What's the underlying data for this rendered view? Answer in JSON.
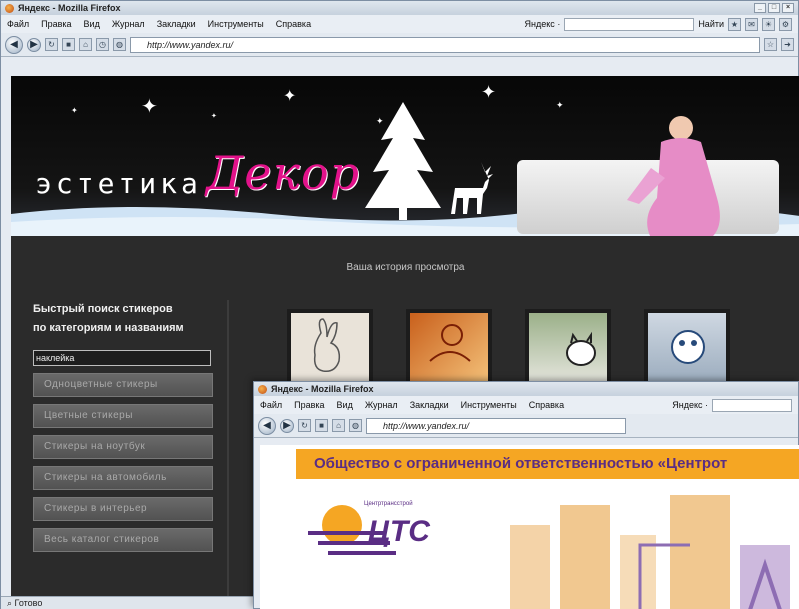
{
  "window": {
    "title": "Яндекс - Mozilla Firefox",
    "controls": [
      "_",
      "□",
      "×"
    ]
  },
  "menu": [
    "Файл",
    "Правка",
    "Вид",
    "Журнал",
    "Закладки",
    "Инструменты",
    "Справка"
  ],
  "toolbar": {
    "yandex_label": "Яндекс ·",
    "find_label": "Найти",
    "url": "http://www.yandex.ru/"
  },
  "site": {
    "brand_left": "эстетика",
    "brand_right": "Декор",
    "history_link": "Ваша история просмотра",
    "sidebar_heading_1": "Быстрый поиск стикеров",
    "sidebar_heading_2": "по категориям и названиям",
    "search_value": "наклейка",
    "categories": [
      "Одноцветные стикеры",
      "Цветные стикеры",
      "Стикеры на ноутбук",
      "Стикеры на автомобиль",
      "Стикеры в интерьер",
      "Весь каталог стикеров"
    ]
  },
  "window2": {
    "title": "Яндекс - Mozilla Firefox",
    "url": "http://www.yandex.ru/",
    "org_banner": "Общество с ограниченной ответственностью «Центрот",
    "logo_small": "Центртрансстрой",
    "logo_big": "ЦТС"
  },
  "status": {
    "text": "Готово"
  },
  "colors": {
    "brand_pink": "#e2128a",
    "org_orange": "#f5a623",
    "org_purple": "#5a2d84"
  }
}
